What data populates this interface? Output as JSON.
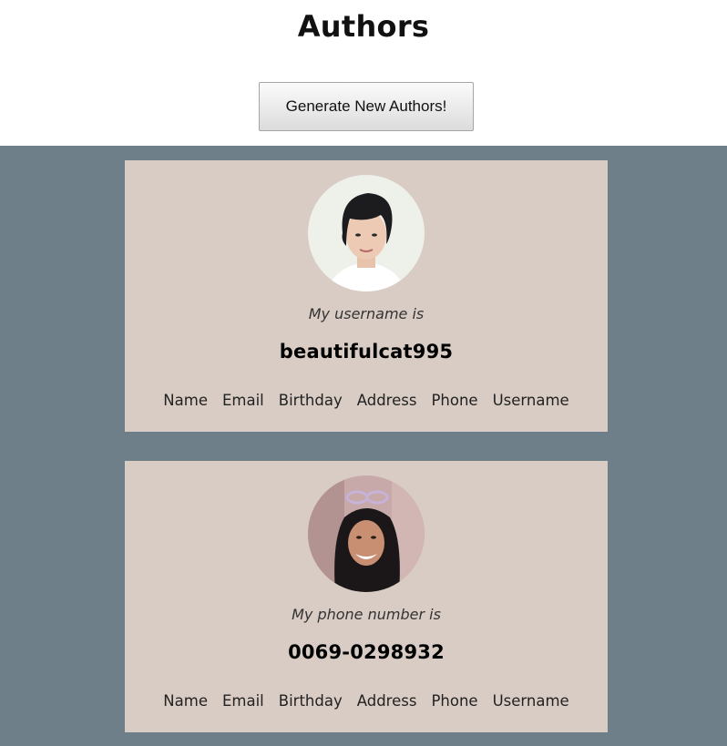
{
  "header": {
    "title": "Authors",
    "generate_button": "Generate New Authors!"
  },
  "colors": {
    "content_background": "#6f7f8a",
    "card_background": "#d9ccc4"
  },
  "cards": [
    {
      "avatar": "avatar-photo-woman-short-hair",
      "label": "My username is",
      "value": "beautifulcat995",
      "tabs": [
        "Name",
        "Email",
        "Birthday",
        "Address",
        "Phone",
        "Username"
      ]
    },
    {
      "avatar": "avatar-photo-woman-long-hair-glasses-on-head",
      "label": "My phone number is",
      "value": "0069-0298932",
      "tabs": [
        "Name",
        "Email",
        "Birthday",
        "Address",
        "Phone",
        "Username"
      ]
    }
  ]
}
